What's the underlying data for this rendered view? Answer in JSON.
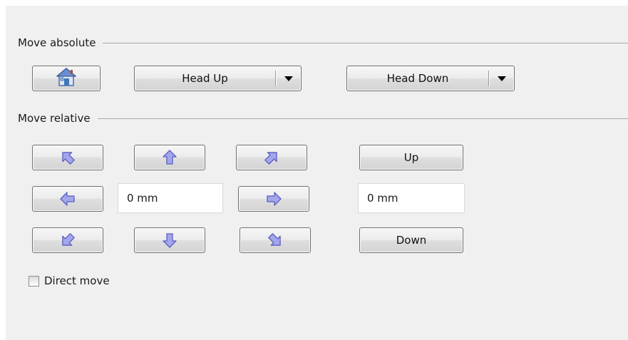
{
  "move_absolute": {
    "title": "Move absolute",
    "home_icon": "home-icon",
    "head_up_label": "Head Up",
    "head_down_label": "Head Down"
  },
  "move_relative": {
    "title": "Move relative",
    "xy_step_value": "0 mm",
    "z_step_value": "0 mm",
    "up_label": "Up",
    "down_label": "Down",
    "arrow_icons": [
      "arrow-up-left-icon",
      "arrow-up-icon",
      "arrow-up-right-icon",
      "arrow-left-icon",
      "arrow-right-icon",
      "arrow-down-left-icon",
      "arrow-down-icon",
      "arrow-down-right-icon"
    ]
  },
  "direct_move": {
    "label": "Direct move",
    "checked": false
  },
  "colors": {
    "arrow_fill": "#a3a6ec",
    "arrow_stroke": "#5a5fbf",
    "panel_bg": "#f0f0f0"
  }
}
